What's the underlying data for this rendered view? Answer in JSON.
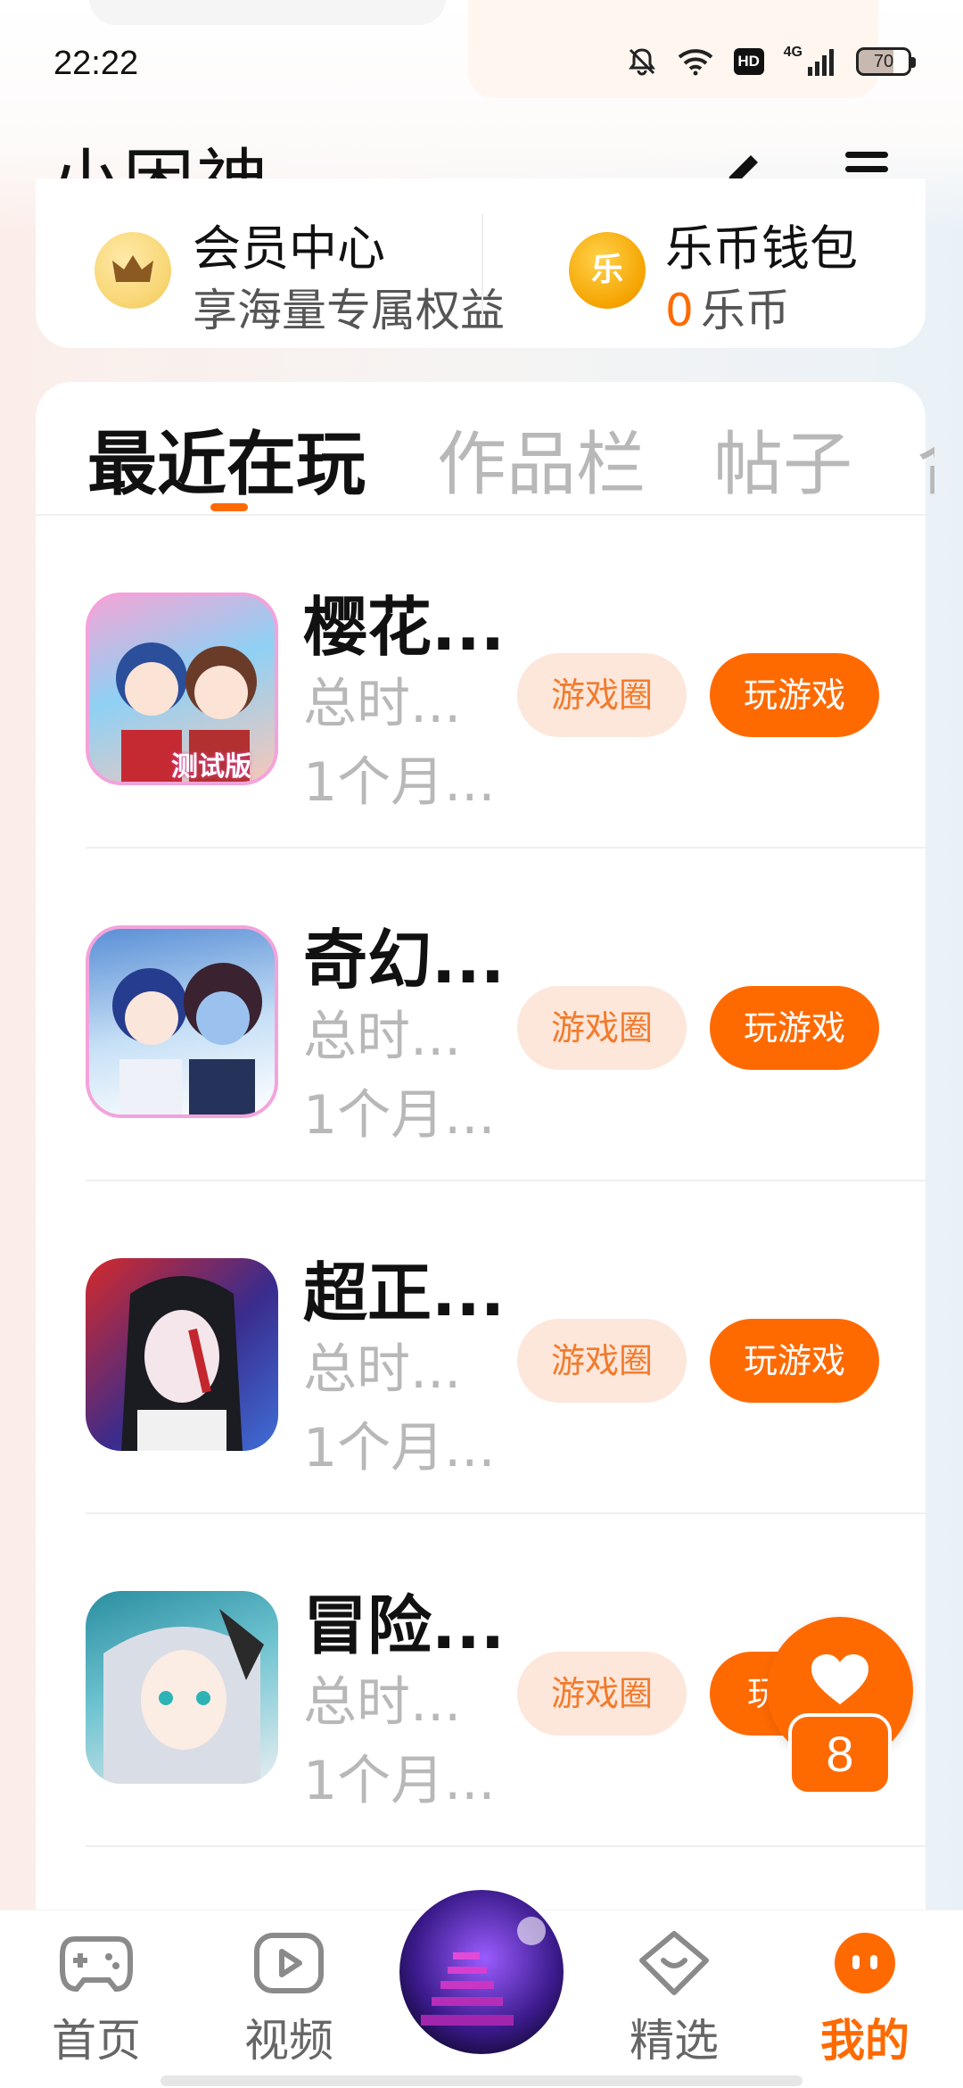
{
  "status_bar": {
    "time": "22:22",
    "network_label": "4G",
    "hd_label": "HD",
    "battery": "70"
  },
  "header": {
    "username": "小困神",
    "edit_icon": "pencil-icon",
    "menu_icon": "hamburger-menu-icon"
  },
  "member_card": {
    "vip": {
      "title": "会员中心",
      "subtitle": "享海量专属权益",
      "icon": "crown-icon"
    },
    "coin": {
      "title": "乐币钱包",
      "count": "0",
      "unit": "乐币",
      "icon_glyph": "乐"
    }
  },
  "tabs": [
    {
      "label": "最近在玩",
      "active": true
    },
    {
      "label": "作品栏",
      "active": false
    },
    {
      "label": "帖子",
      "active": false
    },
    {
      "label": "合",
      "active": false
    }
  ],
  "games": [
    {
      "title": "樱花...",
      "time": "总时...",
      "date": "1个月...",
      "circle_label": "游戏圈",
      "play_label": "玩游戏",
      "thumb_badge": "测试版"
    },
    {
      "title": "奇幻...",
      "time": "总时...",
      "date": "1个月...",
      "circle_label": "游戏圈",
      "play_label": "玩游戏"
    },
    {
      "title": "超正...",
      "time": "总时...",
      "date": "1个月...",
      "circle_label": "游戏圈",
      "play_label": "玩游戏"
    },
    {
      "title": "冒险...",
      "time": "总时...",
      "date": "1个月...",
      "circle_label": "游戏圈",
      "play_label": "玩"
    }
  ],
  "fab_like": {
    "count": "8",
    "icon": "heart-icon"
  },
  "bottom_nav": [
    {
      "label": "首页",
      "icon": "gamepad-icon",
      "active": false
    },
    {
      "label": "视频",
      "icon": "play-video-icon",
      "active": false
    },
    {
      "label": "精选",
      "icon": "heart-diamond-icon",
      "active": false
    },
    {
      "label": "我的",
      "icon": "smiley-icon",
      "active": true
    }
  ],
  "colors": {
    "accent": "#ff6a00",
    "accent_soft": "#fde6da",
    "muted_text": "#b8b8b8"
  }
}
